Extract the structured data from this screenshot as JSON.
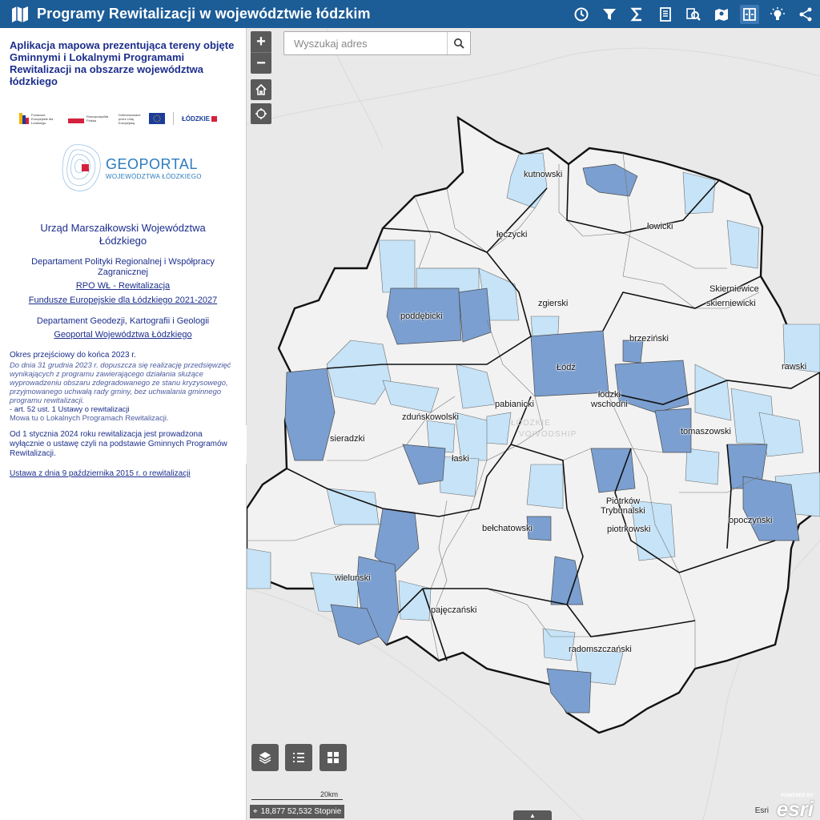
{
  "header": {
    "title": "Programy Rewitalizacji w województwie łódzkim",
    "toolbar": [
      "history-icon",
      "filter-icon",
      "sum-icon",
      "document-icon",
      "zoom-search-icon",
      "print-icon",
      "split-icon",
      "lightbulb-icon",
      "share-icon"
    ]
  },
  "panel": {
    "intro": "Aplikacja mapowa prezentująca tereny objęte Gminnymi i Lokalnymi Programami Rewitalizacji na obszarze województwa łódzkiego",
    "logos": [
      "Fundusze Europejskie dla Łódzkiego",
      "Rzeczpospolita Polska",
      "Dofinansowane przez Unię Europejską",
      "ŁÓDZKIE"
    ],
    "geoportal_title": "GEOPORTAL",
    "geoportal_sub": "WOJEWÓDZTWA ŁÓDZKIEGO",
    "org": "Urząd Marszałkowski Województwa Łódzkiego",
    "dept1": "Departament Polityki Regionalnej i Współpracy Zagranicznej",
    "link1": "RPO WŁ - Rewitalizacja",
    "link2": "Fundusze Europejskie dla Łódzkiego 2021-2027",
    "dept2": "Departament Geodezji, Kartografii i Geologii",
    "link3": "Geoportal Województwa Łódzkiego",
    "period_title": "Okres przejściowy do końca 2023 r.",
    "period_text": "Do dnia 31 grudnia 2023 r. dopuszcza się realizację przedsięwzięć wynikających z programu zawierającego działania służące wyprowadzeniu obszaru zdegradowanego ze stanu kryzysowego, przyjmowanego uchwałą rady gminy, bez uchwalania gminnego programu rewitalizacji.",
    "period_law": "- art. 52 ust. 1 Ustawy o rewitalizacji",
    "period_note": "Mowa tu o Lokalnych Programach Rewitalizacji.",
    "info2024": "Od 1 stycznia 2024 roku rewitalizacja jest prowadzona wyłącznie o ustawę czyli na podstawie Gminnych Programów Rewitalizacji.",
    "law_link": "Ustawa z dnia 9 października 2015 r. o rewitalizacji"
  },
  "map": {
    "search_placeholder": "Wyszukaj adres",
    "zoom_in": "+",
    "zoom_out": "−",
    "scale_label": "20km",
    "coords": "18,877 52,532 Stopnie",
    "attribution": "Esri",
    "powered_by": "POWERED BY",
    "esri_logo": "esri",
    "basemap_label_1": "ŁÓDZKIE",
    "basemap_label_2": "VOIVODSHIP",
    "colors": {
      "dark_program": "#7b9fd0",
      "light_program": "#c6e3f7",
      "no_program": "#f2f2f2",
      "border": "#111111"
    },
    "labels": {
      "kutnowski": "kutnowski",
      "leczycki": "łęczycki",
      "lowicki": "łowicki",
      "skierniewice": "Skierniewice",
      "skierniewicki": "skierniewicki",
      "poddebicki": "poddębicki",
      "zgierski": "zgierski",
      "brzezinski": "brzeziński",
      "lodz": "Łódź",
      "rawski": "rawski",
      "lodzki_wschodni": "łódzki\nwschodni",
      "pabianicki": "pabianicki",
      "zdunskowolski": "zduńskowolski",
      "sieradzki": "sieradzki",
      "laski": "łaski",
      "tomaszowski": "tomaszowski",
      "piotrkow": "Piotrków\nTrybunalski",
      "piotrkowski": "piotrkowski",
      "opoczynski": "opoczyński",
      "belchatowski": "bełchatowski",
      "wielunski": "wieluński",
      "pajeczanski": "pajęczański",
      "radomszczanski": "radomszczański"
    }
  }
}
